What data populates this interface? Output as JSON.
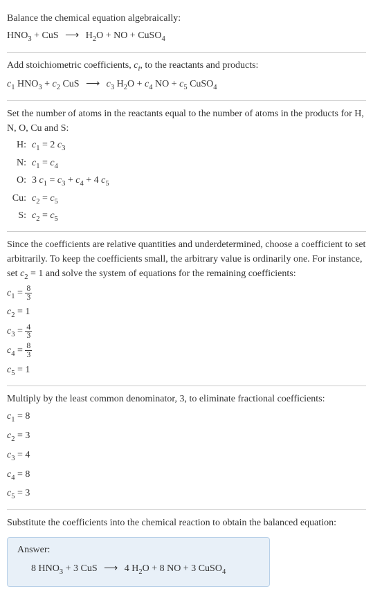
{
  "section1": {
    "title": "Balance the chemical equation algebraically:",
    "eq_prefix": "HNO",
    "eq_sub1": "3",
    "eq_plus1": " + CuS ",
    "eq_arrow": "⟶",
    "eq_h2o": " H",
    "eq_sub2": "2",
    "eq_o": "O + NO + CuSO",
    "eq_sub3": "4"
  },
  "section2": {
    "title_part1": "Add stoichiometric coefficients, ",
    "title_ci": "c",
    "title_i": "i",
    "title_part2": ", to the reactants and products:",
    "c1": "c",
    "s1": "1",
    "hno3": " HNO",
    "sub3a": "3",
    "plus1": " + ",
    "c2": "c",
    "s2": "2",
    "cus": " CuS ",
    "arrow": "⟶",
    "sp1": " ",
    "c3": "c",
    "s3": "3",
    "h2": " H",
    "sub2a": "2",
    "o1": "O + ",
    "c4": "c",
    "s4": "4",
    "no": " NO + ",
    "c5": "c",
    "s5": "5",
    "cuso4": " CuSO",
    "sub4a": "4"
  },
  "section3": {
    "title": "Set the number of atoms in the reactants equal to the number of atoms in the products for H, N, O, Cu and S:",
    "rows": [
      {
        "label": "H:",
        "c": "c",
        "s1": "1",
        "mid": " = 2 ",
        "c2": "c",
        "s2": "3"
      },
      {
        "label": "N:",
        "c": "c",
        "s1": "1",
        "mid": " = ",
        "c2": "c",
        "s2": "4"
      },
      {
        "label": "O:",
        "pre": "3 ",
        "c": "c",
        "s1": "1",
        "mid": " = ",
        "c2": "c",
        "s2": "3",
        "plus1": " + ",
        "c3": "c",
        "s3": "4",
        "plus2": " + 4 ",
        "c4": "c",
        "s4": "5"
      },
      {
        "label": "Cu:",
        "c": "c",
        "s1": "2",
        "mid": " = ",
        "c2": "c",
        "s2": "5"
      },
      {
        "label": "S:",
        "c": "c",
        "s1": "2",
        "mid": " = ",
        "c2": "c",
        "s2": "5"
      }
    ]
  },
  "section4": {
    "title_p1": "Since the coefficients are relative quantities and underdetermined, choose a coefficient to set arbitrarily. To keep the coefficients small, the arbitrary value is ordinarily one. For instance, set ",
    "title_c": "c",
    "title_s": "2",
    "title_p2": " = 1 and solve the system of equations for the remaining coefficients:",
    "c1_c": "c",
    "c1_s": "1",
    "c1_eq": " = ",
    "c1_num": "8",
    "c1_den": "3",
    "c2_c": "c",
    "c2_s": "2",
    "c2_eq": " = 1",
    "c3_c": "c",
    "c3_s": "3",
    "c3_eq": " = ",
    "c3_num": "4",
    "c3_den": "3",
    "c4_c": "c",
    "c4_s": "4",
    "c4_eq": " = ",
    "c4_num": "8",
    "c4_den": "3",
    "c5_c": "c",
    "c5_s": "5",
    "c5_eq": " = 1"
  },
  "section5": {
    "title": "Multiply by the least common denominator, 3, to eliminate fractional coefficients:",
    "lines": [
      {
        "c": "c",
        "s": "1",
        "val": " = 8"
      },
      {
        "c": "c",
        "s": "2",
        "val": " = 3"
      },
      {
        "c": "c",
        "s": "3",
        "val": " = 4"
      },
      {
        "c": "c",
        "s": "4",
        "val": " = 8"
      },
      {
        "c": "c",
        "s": "5",
        "val": " = 3"
      }
    ]
  },
  "section6": {
    "title": "Substitute the coefficients into the chemical reaction to obtain the balanced equation:",
    "answer_label": "Answer:",
    "eq_8": "8 HNO",
    "eq_s3": "3",
    "eq_p1": " + 3 CuS ",
    "eq_arrow": "⟶",
    "eq_p2": " 4 H",
    "eq_s2": "2",
    "eq_p3": "O + 8 NO + 3 CuSO",
    "eq_s4": "4"
  }
}
